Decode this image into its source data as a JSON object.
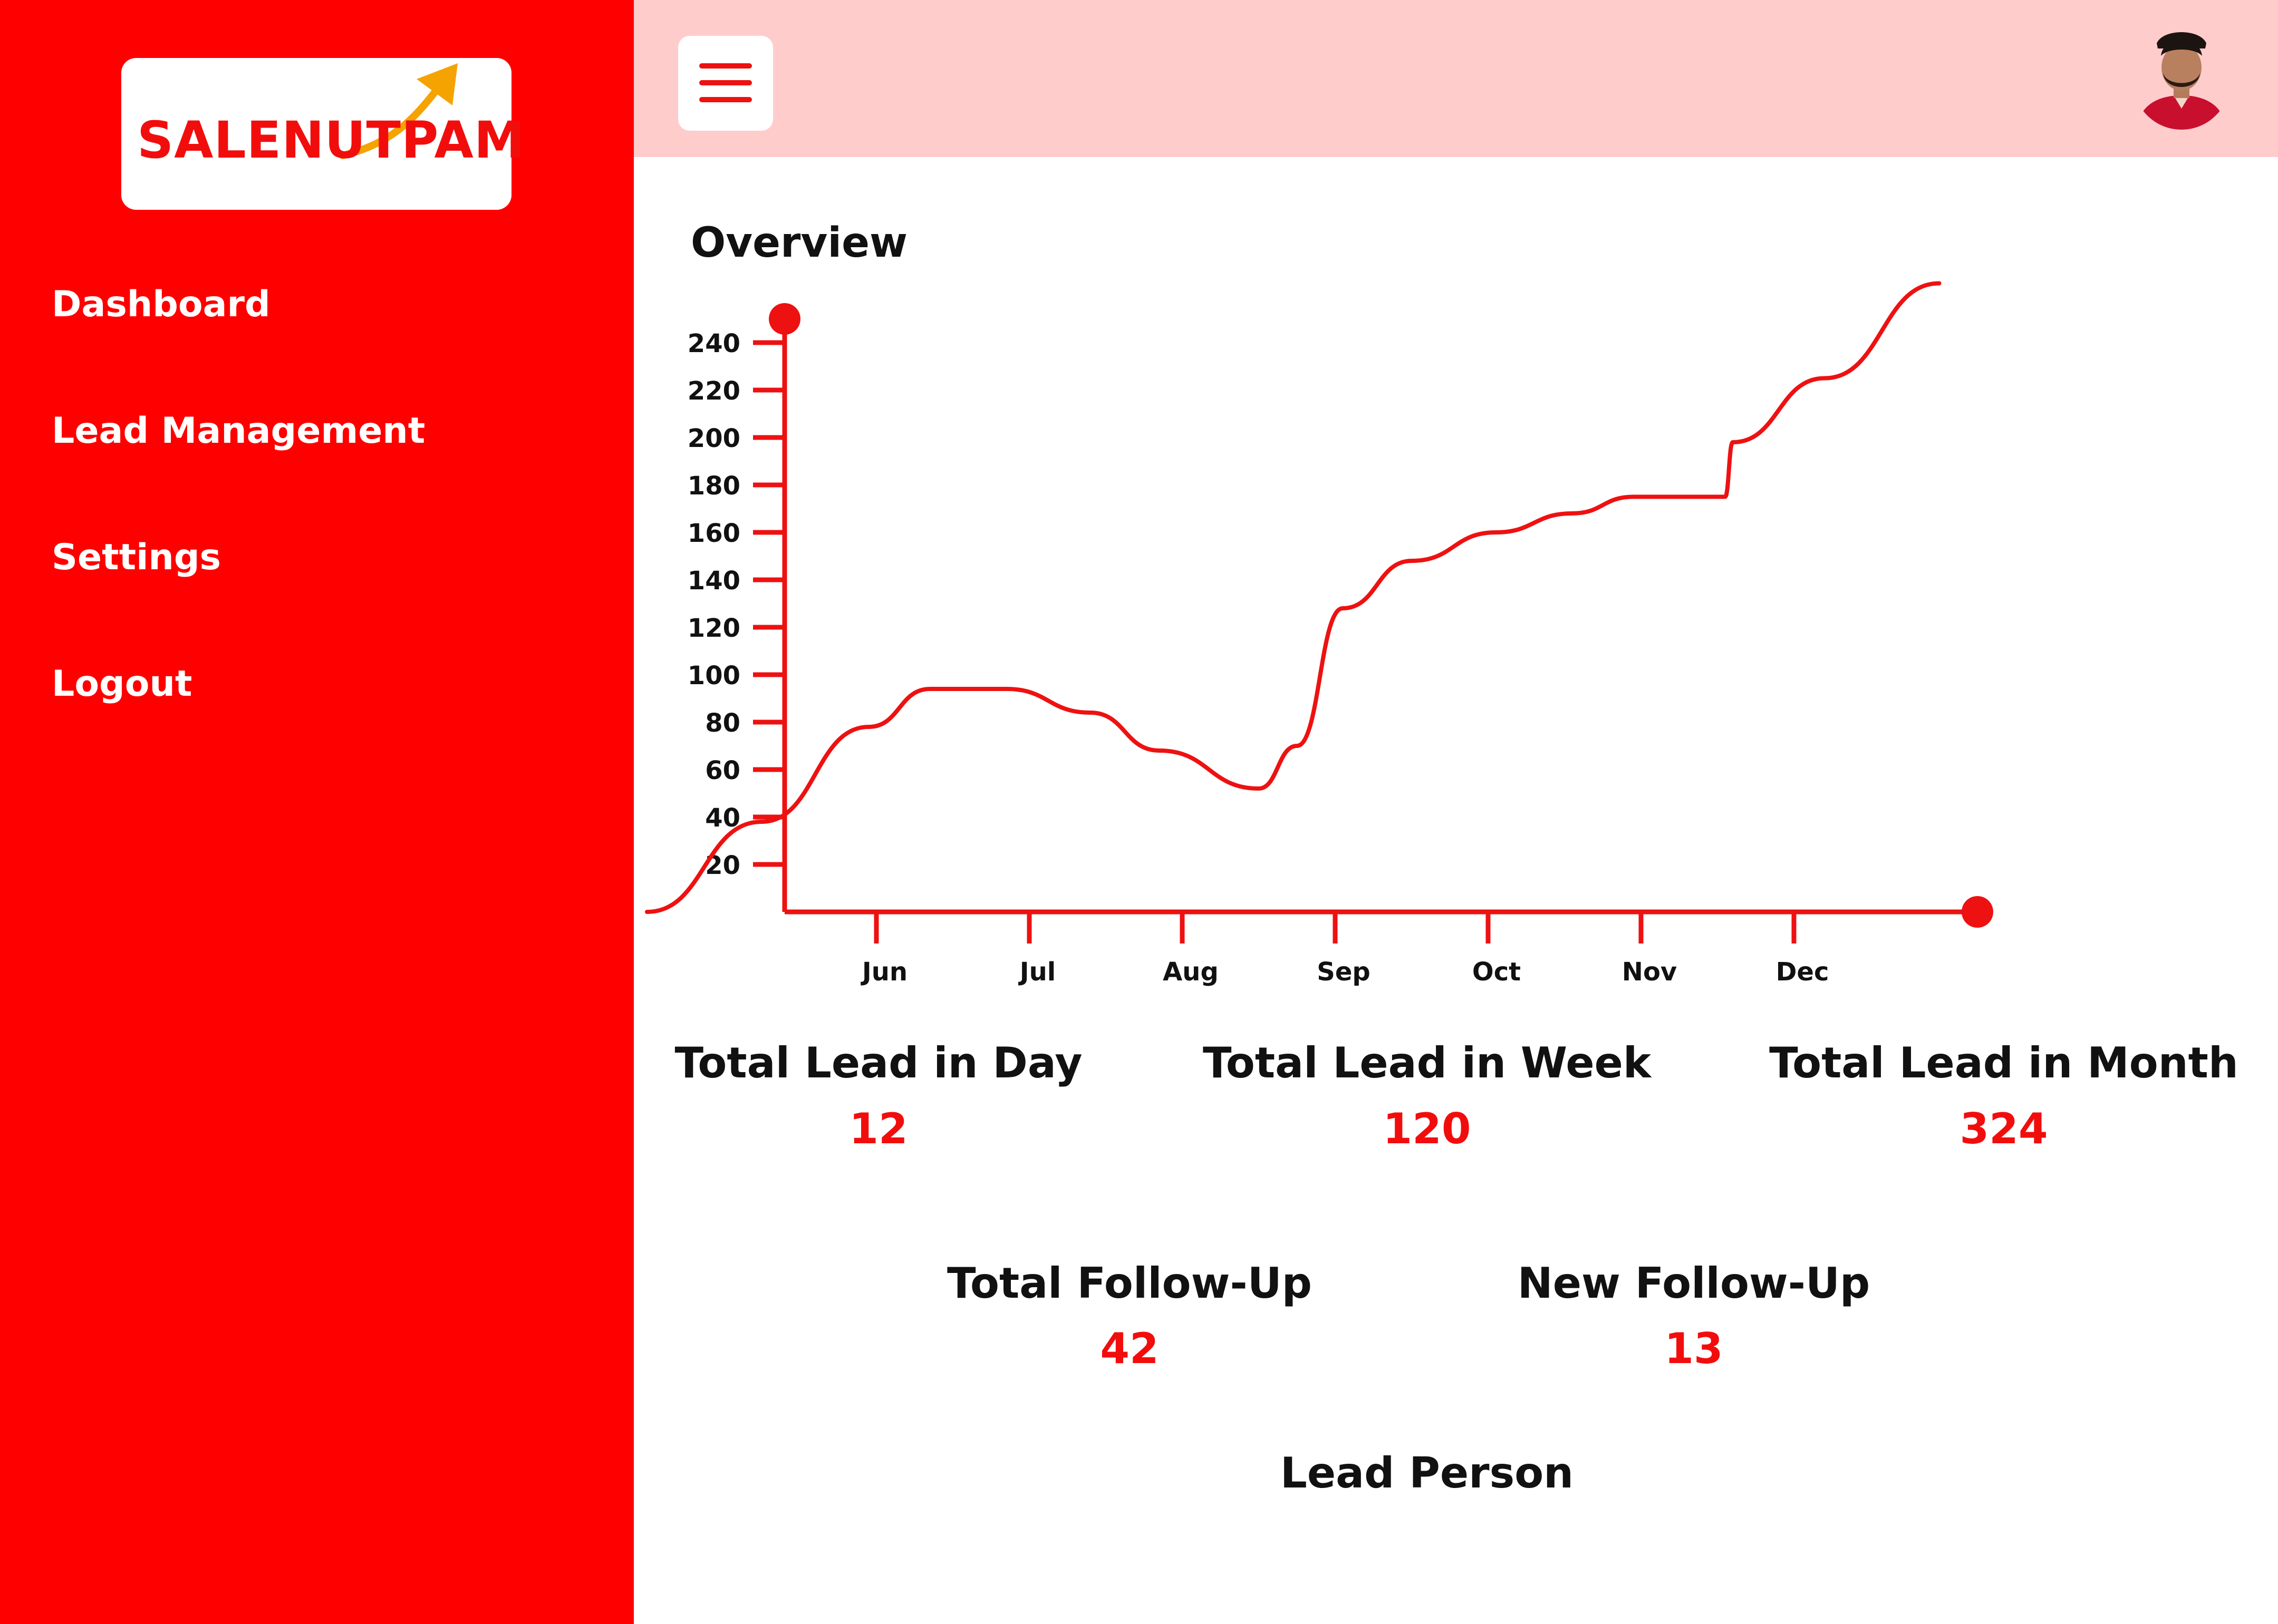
{
  "brand": {
    "logo_text": "SALENUTPAM",
    "primary_color": "#ff0000",
    "topbar_color": "#ffcccc",
    "logo_arrow_color": "#f5a300"
  },
  "sidebar": {
    "items": [
      {
        "label": "Dashboard"
      },
      {
        "label": "Lead Management"
      },
      {
        "label": "Settings"
      },
      {
        "label": "Logout"
      }
    ]
  },
  "header": {
    "menu_icon": "hamburger-menu-icon",
    "avatar_icon": "user-avatar"
  },
  "overview": {
    "title": "Overview"
  },
  "chart_data": {
    "type": "line",
    "title": "",
    "xlabel": "",
    "ylabel": "",
    "x_ticks": [
      "Jun",
      "Jul",
      "Aug",
      "Sep",
      "Oct",
      "Nov",
      "Dec"
    ],
    "y_ticks": [
      20,
      40,
      60,
      80,
      100,
      120,
      140,
      160,
      180,
      200,
      220,
      240
    ],
    "ylim": [
      0,
      250
    ],
    "grid": false,
    "legend": "none",
    "series_color": "#ee1111",
    "series": [
      {
        "points": [
          [
            "May",
            0
          ],
          [
            "late May",
            38
          ],
          [
            "Jun",
            78
          ],
          [
            "mid Jun",
            94
          ],
          [
            "Jul",
            94
          ],
          [
            "mid Jul",
            84
          ],
          [
            "Aug",
            68
          ],
          [
            "mid Aug",
            52
          ],
          [
            "late Aug",
            70
          ],
          [
            "Sep",
            128
          ],
          [
            "mid Sep",
            148
          ],
          [
            "Oct",
            160
          ],
          [
            "mid Oct",
            168
          ],
          [
            "early Nov",
            175
          ],
          [
            "Nov",
            175
          ],
          [
            "late Nov",
            175
          ],
          [
            "early Dec",
            198
          ],
          [
            "Dec",
            225
          ],
          [
            "late Dec",
            265
          ]
        ]
      }
    ]
  },
  "stats": {
    "day": {
      "label": "Total Lead in Day",
      "value": "12"
    },
    "week": {
      "label": "Total Lead in Week",
      "value": "120"
    },
    "month": {
      "label": "Total Lead in Month",
      "value": "324"
    },
    "total_followup": {
      "label": "Total Follow-Up",
      "value": "42"
    },
    "new_followup": {
      "label": "New Follow-Up",
      "value": "13"
    }
  },
  "lead_person": {
    "title": "Lead Person"
  }
}
